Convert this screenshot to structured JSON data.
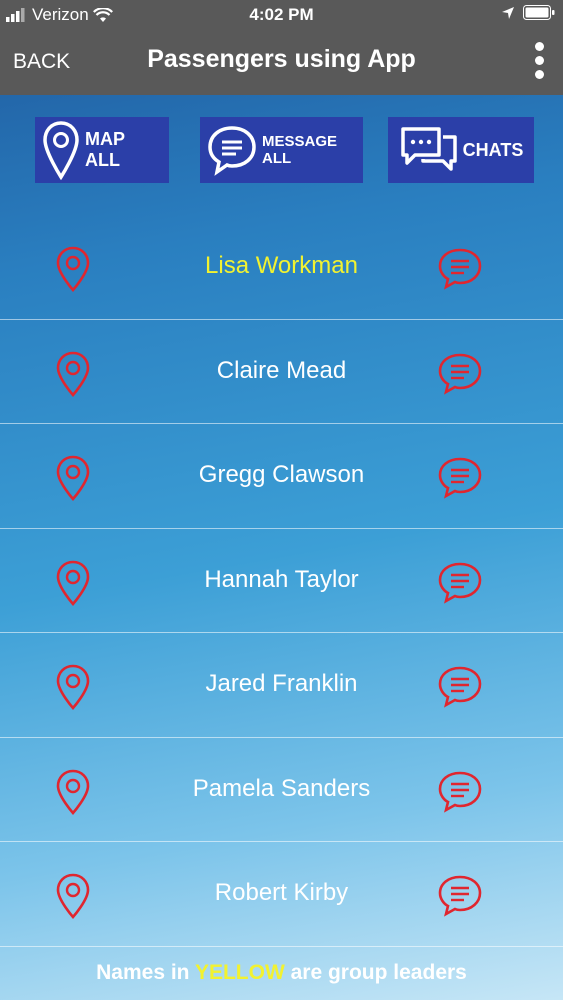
{
  "status_bar": {
    "carrier": "Verizon",
    "time": "4:02 PM"
  },
  "nav": {
    "back_label": "BACK",
    "title": "Passengers using App"
  },
  "actions": {
    "map_all": "MAP ALL",
    "message_all": "MESSAGE ALL",
    "chats": "CHATS"
  },
  "passengers": [
    {
      "name": "Lisa Workman",
      "leader": true
    },
    {
      "name": "Claire Mead",
      "leader": false
    },
    {
      "name": "Gregg Clawson",
      "leader": false
    },
    {
      "name": "Hannah Taylor",
      "leader": false
    },
    {
      "name": "Jared Franklin",
      "leader": false
    },
    {
      "name": "Pamela Sanders",
      "leader": false
    },
    {
      "name": "Robert Kirby",
      "leader": false
    }
  ],
  "footer": {
    "before": "Names in ",
    "highlight": "YELLOW",
    "after": " are group leaders"
  },
  "colors": {
    "leader": "#f2f230",
    "icon_red": "#e0262f",
    "button_blue": "#2b3fa8",
    "bar_gray": "#595959"
  }
}
